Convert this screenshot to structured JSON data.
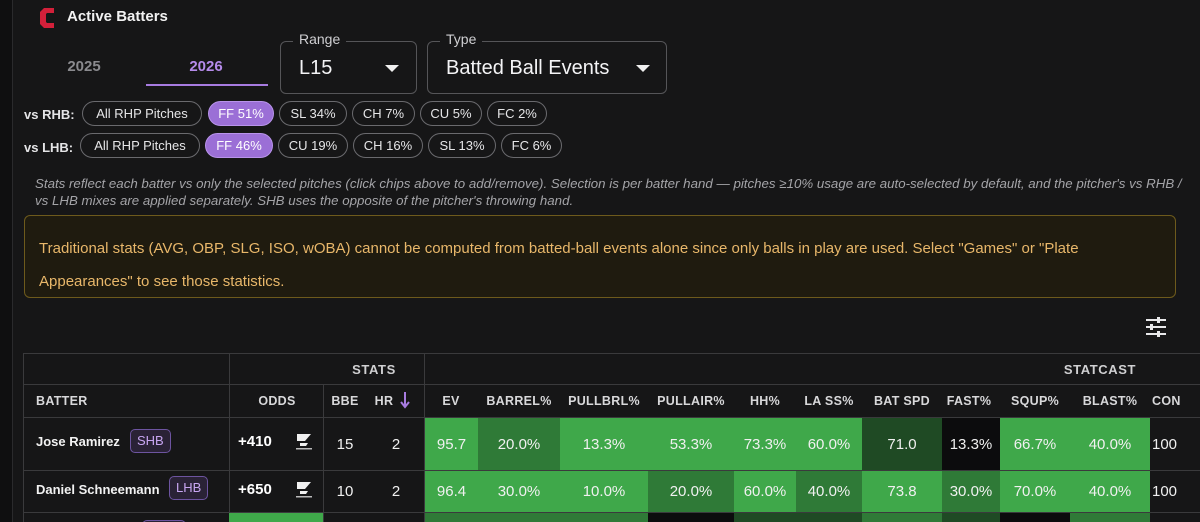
{
  "header": {
    "title": "Active Batters"
  },
  "seasons": {
    "tab_2025": "2025",
    "tab_2026": "2026",
    "active": "2026"
  },
  "filters": {
    "range": {
      "label": "Range",
      "value": "L15"
    },
    "type": {
      "label": "Type",
      "value": "Batted Ball Events"
    }
  },
  "pitch_filters": {
    "vs_rhb": {
      "label": "vs RHB:",
      "chips": [
        {
          "label": "All RHP Pitches",
          "active": false
        },
        {
          "label": "FF 51%",
          "active": true
        },
        {
          "label": "SL 34%",
          "active": false
        },
        {
          "label": "CH 7%",
          "active": false
        },
        {
          "label": "CU 5%",
          "active": false
        },
        {
          "label": "FC 2%",
          "active": false
        }
      ]
    },
    "vs_lhb": {
      "label": "vs LHB:",
      "chips": [
        {
          "label": "All RHP Pitches",
          "active": false
        },
        {
          "label": "FF 46%",
          "active": true
        },
        {
          "label": "CU 19%",
          "active": false
        },
        {
          "label": "CH 16%",
          "active": false
        },
        {
          "label": "SL 13%",
          "active": false
        },
        {
          "label": "FC 6%",
          "active": false
        }
      ]
    }
  },
  "note": "Stats reflect each batter vs only the selected pitches (click chips above to add/remove). Selection is per batter hand — pitches ≥10% usage are auto-selected by default, and the pitcher's vs RHB / vs LHB mixes are applied separately. SHB uses the opposite of the pitcher's throwing hand.",
  "warning": "Traditional stats (AVG, OBP, SLG, ISO, wOBA) cannot be computed from batted-ball events alone since only balls in play are used. Select \"Games\" or \"Plate Appearances\" to see those statistics.",
  "table": {
    "group_headers": {
      "stats": "STATS",
      "statcast": "STATCAST"
    },
    "columns": {
      "batter": "BATTER",
      "odds": "ODDS",
      "bbe": "BBE",
      "hr": "HR",
      "ev": "EV",
      "barrel": "BARREL%",
      "pullbrl": "PULLBRL%",
      "pullair": "PULLAIR%",
      "hh": "HH%",
      "lass": "LA SS%",
      "batspd": "BAT SPD",
      "fast": "FAST%",
      "squp": "SQUP%",
      "blast": "BLAST%",
      "con": "CON"
    },
    "sort": {
      "column": "hr",
      "direction": "desc",
      "icon": "arrow-down-icon"
    },
    "rows": [
      {
        "name": "Jose Ramirez",
        "hand": "SHB",
        "odds": "+410",
        "book_icon": "sportsbook-logo-icon",
        "bbe": "15",
        "hr": "2",
        "ev": "95.7",
        "barrel": "20.0%",
        "pullbrl": "13.3%",
        "pullair": "53.3%",
        "hh": "73.3%",
        "lass": "60.0%",
        "batspd": "71.0",
        "fast": "13.3%",
        "squp": "66.7%",
        "blast": "40.0%",
        "con": "100"
      },
      {
        "name": "Daniel Schneemann",
        "hand": "LHB",
        "odds": "+650",
        "book_icon": "sportsbook-logo-icon",
        "bbe": "10",
        "hr": "2",
        "ev": "96.4",
        "barrel": "30.0%",
        "pullbrl": "10.0%",
        "pullair": "20.0%",
        "hh": "60.0%",
        "lass": "40.0%",
        "batspd": "73.8",
        "fast": "30.0%",
        "squp": "70.0%",
        "blast": "40.0%",
        "con": "100"
      }
    ]
  },
  "colors": {
    "accent": "#9b6fd6",
    "warning_text": "#e8b76a",
    "heat_strong": "#3fa84a",
    "heat_medium": "#2f7a37",
    "heat_weak": "#1f4a24",
    "neutral_cell": "#0c0c0d"
  }
}
